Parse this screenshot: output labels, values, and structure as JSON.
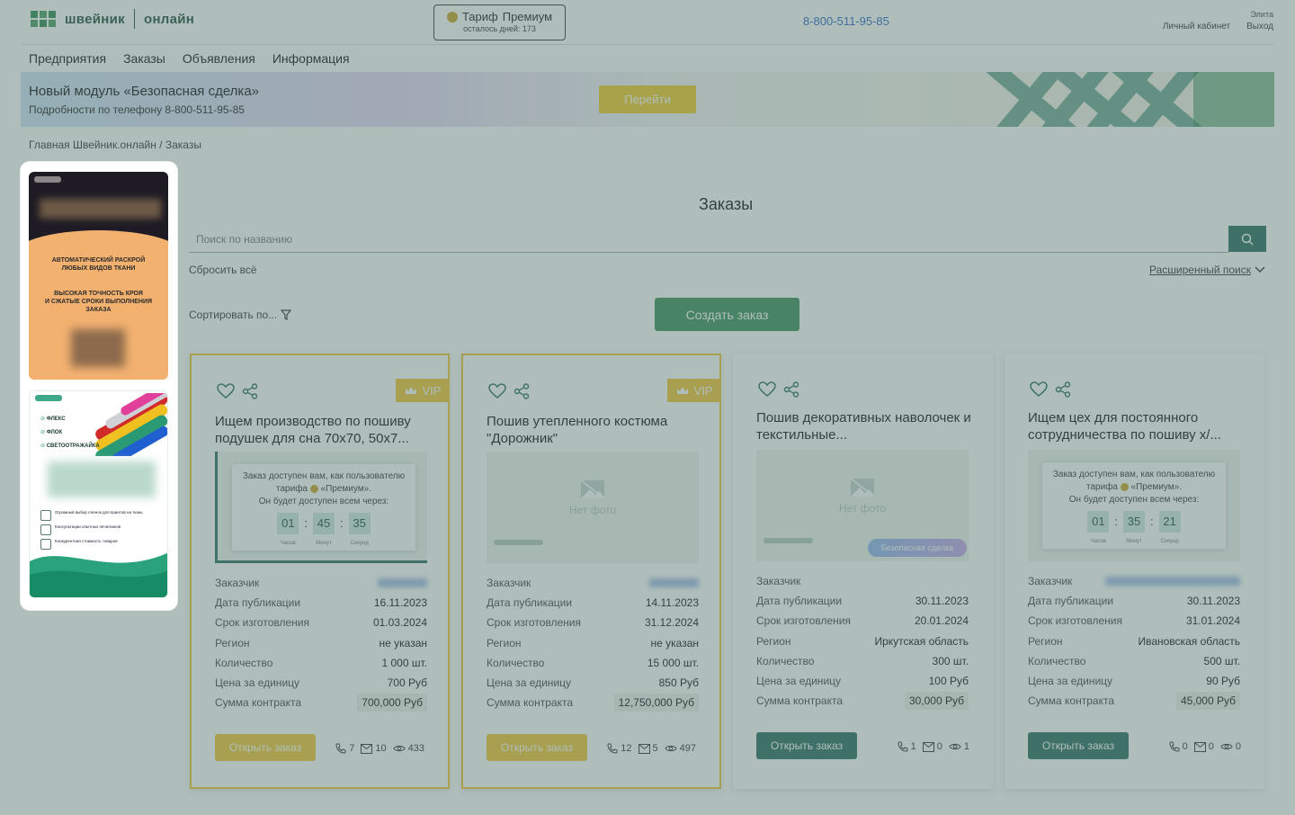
{
  "header": {
    "logo_left": "швейник",
    "logo_right": "онлайн",
    "tariff_label": "Тариф",
    "tariff_name": "Премиум",
    "tariff_days": "осталось дней: 173",
    "phone": "8-800-511-95-85",
    "user_name": "Элита",
    "cabinet": "Личный кабинет",
    "logout": "Выход"
  },
  "nav": [
    "Предприятия",
    "Заказы",
    "Объявления",
    "Информация"
  ],
  "banner": {
    "title": "Новый модуль «Безопасная сделка»",
    "subtitle": "Подробности по телефону 8-800-511-95-85",
    "button": "Перейти"
  },
  "breadcrumb": "Главная Швейник.онлайн / Заказы",
  "ads": {
    "ad1_line1": "АВТОМАТИЧЕСКИЙ РАСКРОЙ",
    "ad1_line2": "ЛЮБЫХ ВИДОВ ТКАНИ",
    "ad1_line3": "ВЫСОКАЯ ТОЧНОСТЬ КРОЯ",
    "ad1_line4": "И СЖАТЫЕ СРОКИ ВЫПОЛНЕНИЯ",
    "ad1_line5": "ЗАКАЗА",
    "ad2_items": [
      "ФЛЕКС",
      "ФЛОК",
      "СВЕТООТРАЖАЙКА"
    ],
    "ad2_features": [
      "Огромный выбор пленок для принтов на ткань",
      "Консультации опытных печатников",
      "Конкурентная стоимость товаров"
    ]
  },
  "main": {
    "title": "Заказы",
    "search_placeholder": "Поиск по названию",
    "reset": "Сбросить всё",
    "advanced": "Расширенный поиск",
    "sort": "Сортировать по...",
    "create": "Создать заказ"
  },
  "labels": {
    "customer": "Заказчик",
    "published": "Дата публикации",
    "deadline": "Срок изготовления",
    "region": "Регион",
    "quantity": "Количество",
    "unit_price": "Цена за единицу",
    "total": "Сумма контракта",
    "open": "Открыть заказ",
    "vip": "VIP",
    "no_photo": "Нет фото",
    "safe_deal": "Безопасная сделка",
    "timer_l1": "Заказ доступен вам, как пользователю",
    "timer_l2a": "тарифа",
    "timer_l2b": "«Премиум».",
    "timer_l3": "Он будет доступен всем через:",
    "hours": "Часов",
    "minutes": "Минут",
    "seconds": "Секунд"
  },
  "cards": [
    {
      "title": "Ищем производство по пошиву подушек для сна 70х70, 50х7...",
      "published": "16.11.2023",
      "deadline": "01.03.2024",
      "region": "не указан",
      "quantity": "1 000 шт.",
      "unit_price": "700 Руб",
      "total": "700,000 Руб",
      "timer": [
        "01",
        "45",
        "35"
      ],
      "calls": "7",
      "messages": "10",
      "views": "433"
    },
    {
      "title": "Пошив утепленного костюма \"Дорожник\"",
      "published": "14.11.2023",
      "deadline": "31.12.2024",
      "region": "не указан",
      "quantity": "15 000 шт.",
      "unit_price": "850 Руб",
      "total": "12,750,000 Руб",
      "calls": "12",
      "messages": "5",
      "views": "497"
    },
    {
      "title": "Пошив декоративных наволочек и текстильные...",
      "published": "30.11.2023",
      "deadline": "20.01.2024",
      "region": "Иркутская область",
      "quantity": "300 шт.",
      "unit_price": "100 Руб",
      "total": "30,000 Руб",
      "calls": "1",
      "messages": "0",
      "views": "1"
    },
    {
      "title": "Ищем цех для постоянного сотрудничества по пошиву х/...",
      "published": "30.11.2023",
      "deadline": "31.01.2024",
      "region": "Ивановская область",
      "quantity": "500 шт.",
      "unit_price": "90 Руб",
      "total": "45,000 Руб",
      "timer": [
        "01",
        "35",
        "21"
      ],
      "calls": "0",
      "messages": "0",
      "views": "0"
    }
  ]
}
